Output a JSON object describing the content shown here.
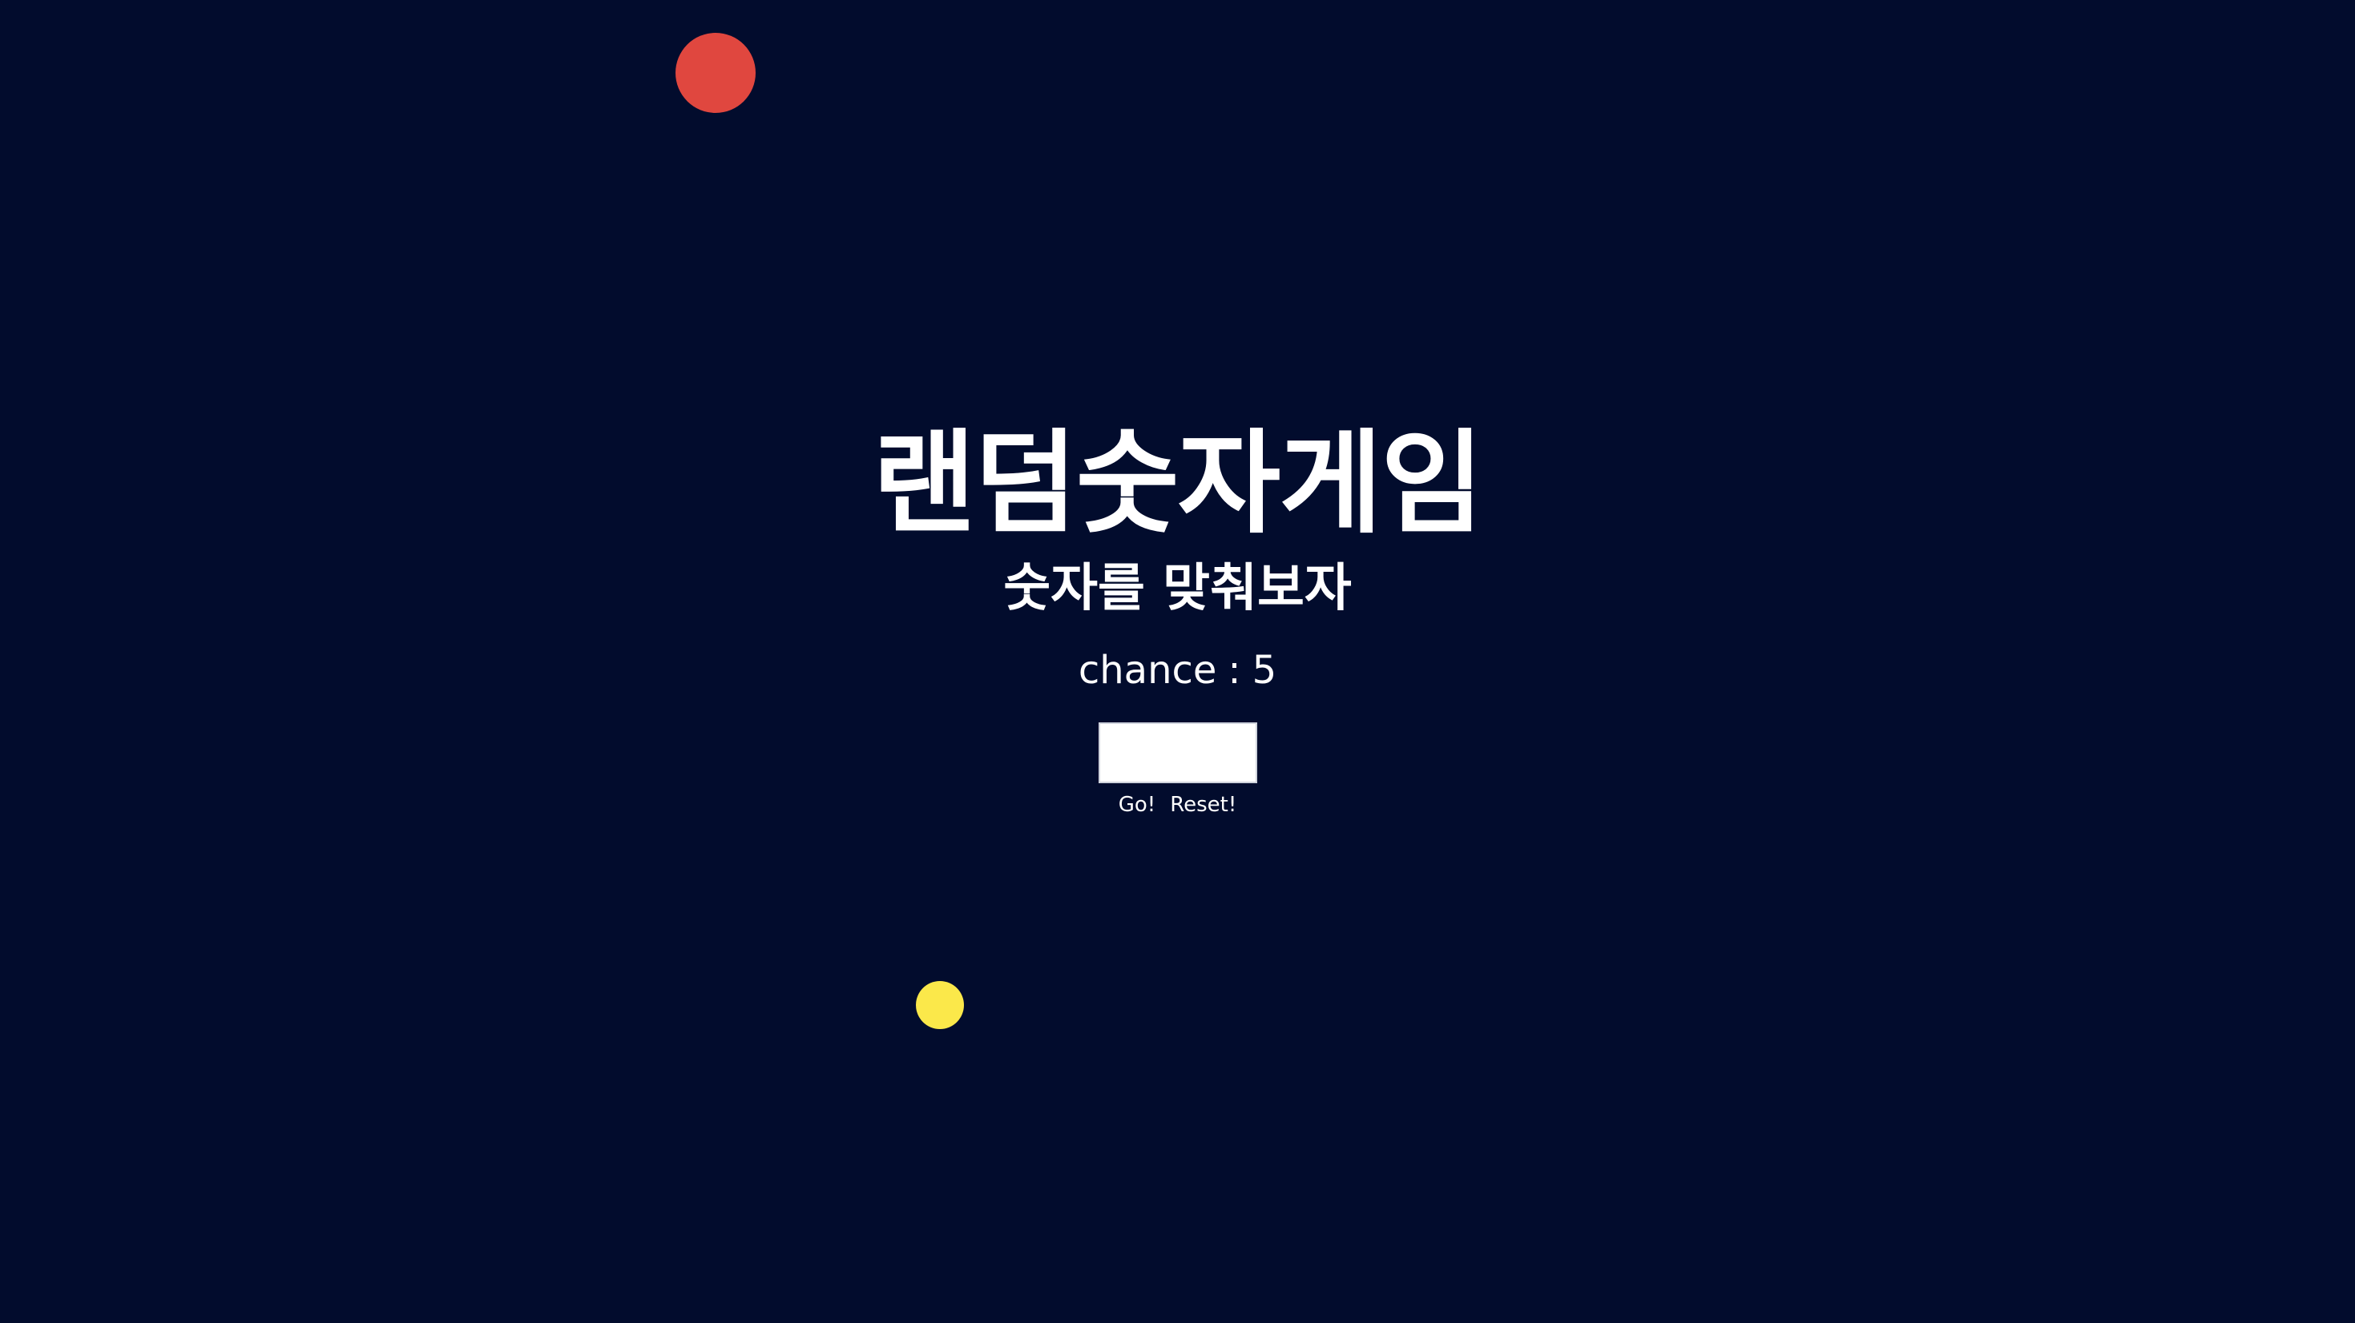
{
  "app": {
    "title": "랜덤숫자게임",
    "subtitle": "숫자를 맞춰보자"
  },
  "chance": {
    "label": "chance",
    "separator": ":",
    "value": "5"
  },
  "input": {
    "value": "",
    "placeholder": ""
  },
  "buttons": {
    "go_label": "Go!",
    "reset_label": "Reset!"
  },
  "colors": {
    "background": "#020c2d",
    "orb_red": "#e0473f",
    "orb_yellow": "#fbe84a"
  }
}
